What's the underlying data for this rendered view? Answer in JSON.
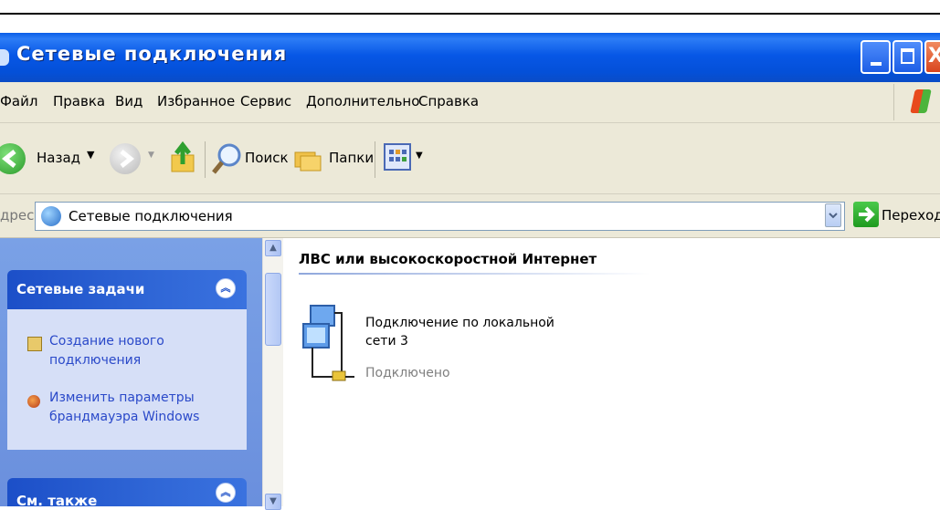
{
  "window": {
    "title": "Сетевые подключения",
    "buttons": {
      "minimize": "minimize",
      "maximize": "maximize",
      "close": "close"
    }
  },
  "menu": [
    "Файл",
    "Правка",
    "Вид",
    "Избранное",
    "Сервис",
    "Дополнительно",
    "Справка"
  ],
  "toolbar": {
    "back_label": "Назад",
    "search_label": "Поиск",
    "folders_label": "Папки"
  },
  "address": {
    "label": "дрес:",
    "value": "Сетевые подключения",
    "go_label": "Переход"
  },
  "left_pane": {
    "network_tasks": {
      "title": "Сетевые задачи",
      "items": [
        {
          "line1": "Создание нового",
          "line2": "подключения",
          "icon": "new-connection-icon"
        },
        {
          "line1": "Изменить параметры",
          "line2": "брандмауэра Windows",
          "icon": "firewall-icon"
        }
      ]
    },
    "see_also": {
      "title": "См. также"
    }
  },
  "content": {
    "group_title": "ЛВС или высокоскоростной Интернет",
    "connection": {
      "name_line1": "Подключение по локальной",
      "name_line2": "сети 3",
      "status": "Подключено",
      "icon": "lan-connection-icon"
    }
  },
  "colors": {
    "titlebar": "#0757e6",
    "chrome": "#ece9d8",
    "pane": "#6a8fdd",
    "link": "#2a49c9"
  }
}
